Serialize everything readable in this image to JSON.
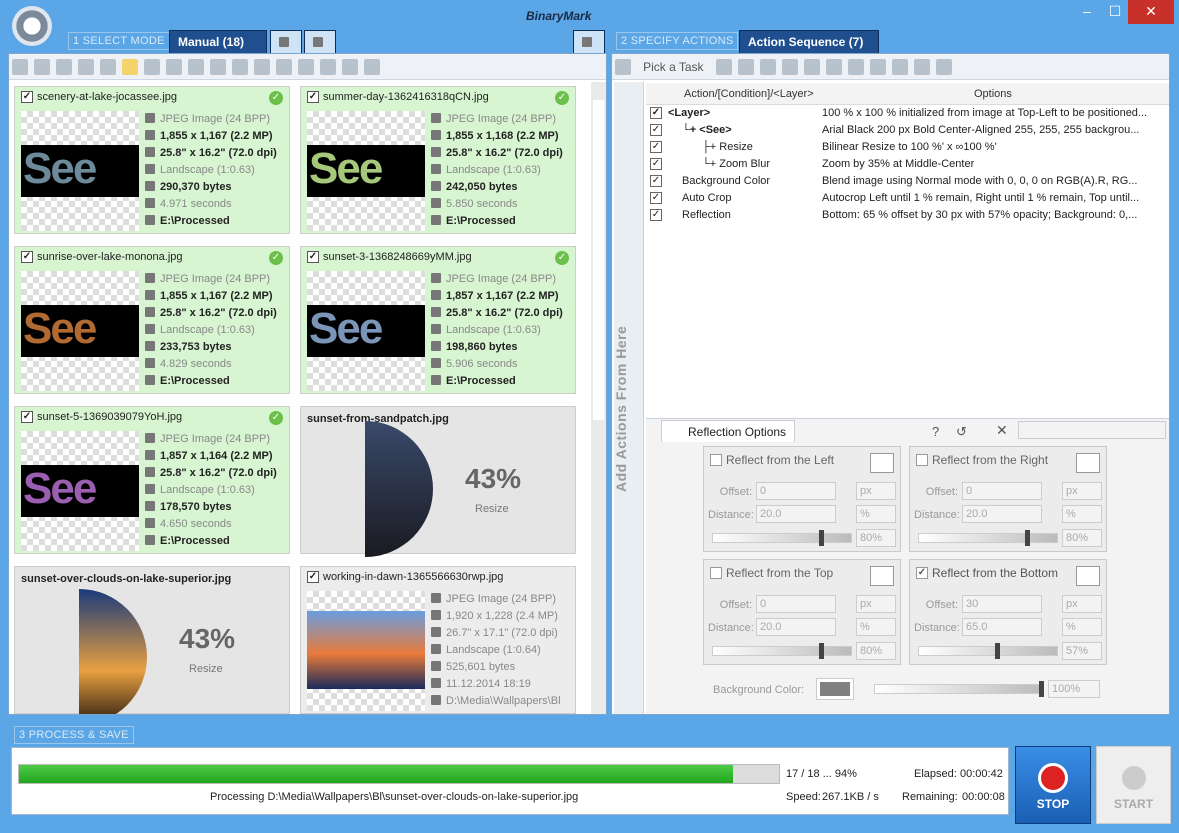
{
  "window": {
    "brand": "BinaryMark",
    "minimize": "–",
    "maximize": "☐",
    "close": "✕"
  },
  "step1": {
    "label": "1 SELECT MODE",
    "tab_manual": "Manual (18)"
  },
  "step2": {
    "label": "2 SPECIFY ACTIONS",
    "tab_sequence": "Action Sequence (7)",
    "pick_task": "Pick a Task"
  },
  "step3": {
    "label": "3 PROCESS & SAVE"
  },
  "files": [
    {
      "name": "scenery-at-lake-jocassee.jpg",
      "type": "JPEG Image (24 BPP)",
      "dims": "1,855 x 1,167 (2.2 MP)",
      "print": "25.8\" x 16.2\" (72.0 dpi)",
      "orient": "Landscape (1:0.63)",
      "size": "290,370 bytes",
      "time": "4.971 seconds",
      "dest": "E:\\Processed"
    },
    {
      "name": "summer-day-1362416318qCN.jpg",
      "type": "JPEG Image (24 BPP)",
      "dims": "1,855 x 1,168 (2.2 MP)",
      "print": "25.8\" x 16.2\" (72.0 dpi)",
      "orient": "Landscape (1:0.63)",
      "size": "242,050 bytes",
      "time": "5.850 seconds",
      "dest": "E:\\Processed"
    },
    {
      "name": "sunrise-over-lake-monona.jpg",
      "type": "JPEG Image (24 BPP)",
      "dims": "1,855 x 1,167 (2.2 MP)",
      "print": "25.8\" x 16.2\" (72.0 dpi)",
      "orient": "Landscape (1:0.63)",
      "size": "233,753 bytes",
      "time": "4.829 seconds",
      "dest": "E:\\Processed"
    },
    {
      "name": "sunset-3-1368248669yMM.jpg",
      "type": "JPEG Image (24 BPP)",
      "dims": "1,857 x 1,167 (2.2 MP)",
      "print": "25.8\" x 16.2\" (72.0 dpi)",
      "orient": "Landscape (1:0.63)",
      "size": "198,860 bytes",
      "time": "5.906 seconds",
      "dest": "E:\\Processed"
    },
    {
      "name": "sunset-5-1369039079YoH.jpg",
      "type": "JPEG Image (24 BPP)",
      "dims": "1,857 x 1,164 (2.2 MP)",
      "print": "25.8\" x 16.2\" (72.0 dpi)",
      "orient": "Landscape (1:0.63)",
      "size": "178,570 bytes",
      "time": "4.650 seconds",
      "dest": "E:\\Processed"
    },
    {
      "name": "sunset-from-sandpatch.jpg",
      "percent": "43%",
      "status": "Resize",
      "progress": 0.43
    },
    {
      "name": "sunset-over-clouds-on-lake-superior.jpg",
      "percent": "43%",
      "status": "Resize",
      "progress": 0.43
    },
    {
      "name": "working-in-dawn-1365566630rwp.jpg",
      "type": "JPEG Image (24 BPP)",
      "dims": "1,920 x 1,228 (2.4 MP)",
      "print": "26.7\" x 17.1\" (72.0 dpi)",
      "orient": "Landscape (1:0.64)",
      "size": "525,601 bytes",
      "time": "11.12.2014 18:19",
      "dest": "D:\\Media\\Wallpapers\\Bl"
    }
  ],
  "seq": {
    "col1": "Action/[Condition]/<Layer>",
    "col2": "Options",
    "rows": [
      {
        "name": "<Layer>",
        "options": "100 % x 100 % initialized from image at Top-Left to be positioned..."
      },
      {
        "name": "└+ <See>",
        "options": "Arial Black 200 px Bold Center-Aligned 255, 255, 255 backgrou..."
      },
      {
        "name": "├+ Resize",
        "options": "Bilinear Resize to 100 %' x ∞100 %'"
      },
      {
        "name": "└+ Zoom Blur",
        "options": "Zoom by 35% at Middle-Center"
      },
      {
        "name": "Background Color",
        "options": "Blend image using Normal mode with 0, 0, 0 on RGB(A).R, RG..."
      },
      {
        "name": "Auto Crop",
        "options": "Autocrop Left until 1 % remain, Right until 1 % remain, Top until..."
      },
      {
        "name": "Reflection",
        "options": "Bottom: 65 % offset by 30 px with 57% opacity; Background: 0,..."
      }
    ]
  },
  "sidebar": {
    "add_actions": "Add Actions From Here"
  },
  "reflection": {
    "tab": "Reflection Options",
    "left": {
      "title": "Reflect from the Left",
      "offset": "0",
      "offset_unit": "px",
      "distance": "20.0",
      "distance_unit": "%",
      "opacity": "80%",
      "opacity_value": 0.8
    },
    "right": {
      "title": "Reflect from the Right",
      "offset": "0",
      "offset_unit": "px",
      "distance": "20.0",
      "distance_unit": "%",
      "opacity": "80%",
      "opacity_value": 0.8
    },
    "top": {
      "title": "Reflect from the Top",
      "offset": "0",
      "offset_unit": "px",
      "distance": "20.0",
      "distance_unit": "%",
      "opacity": "80%",
      "opacity_value": 0.8
    },
    "bottom": {
      "title": "Reflect from the Bottom",
      "offset": "30",
      "offset_unit": "px",
      "distance": "65.0",
      "distance_unit": "%",
      "opacity": "57%",
      "opacity_value": 0.57
    },
    "offset_label": "Offset:",
    "distance_label": "Distance:",
    "bg_label": "Background Color:",
    "bg_opacity": "100%",
    "bg_color": "#808080"
  },
  "process": {
    "counter": "17 / 18 ... 94%",
    "progress": 0.94,
    "elapsed_label": "Elapsed:",
    "elapsed": "00:00:42",
    "processing": "Processing D:\\Media\\Wallpapers\\Bl\\sunset-over-clouds-on-lake-superior.jpg",
    "speed_label": "Speed:",
    "speed": "267.1KB / s",
    "remaining_label": "Remaining:",
    "remaining": "00:00:08",
    "stop": "STOP",
    "start": "START"
  },
  "colors": {
    "accent": "#1f4f8f",
    "done_bg": "#d8f5d2",
    "progress": "#2fb42a"
  }
}
